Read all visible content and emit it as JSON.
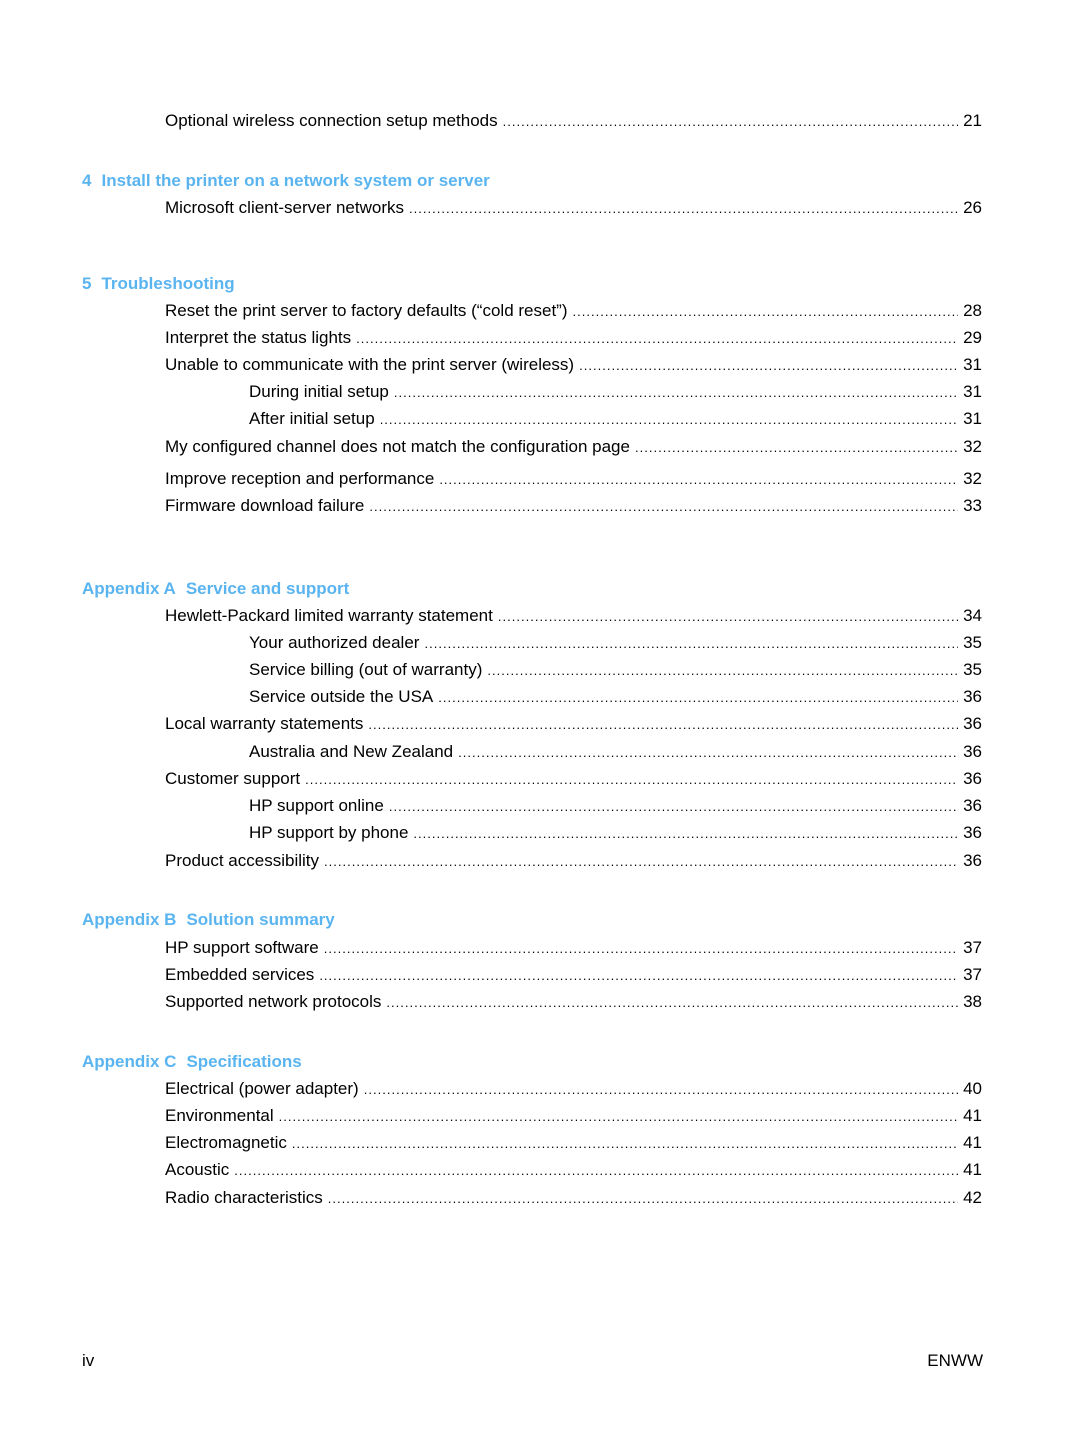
{
  "document": {
    "type": "table-of-contents",
    "accent_color": "#5ab4f0"
  },
  "toc": {
    "top_entries": [
      {
        "title": "Optional wireless connection setup methods",
        "page": "21",
        "level": 1
      }
    ],
    "sections": [
      {
        "number": "4",
        "title": "Install the printer on a network system or server",
        "entries": [
          {
            "title": "Microsoft client-server networks",
            "page": "26",
            "level": 1
          }
        ]
      },
      {
        "number": "5",
        "title": "Troubleshooting",
        "entries": [
          {
            "title": "Reset the print server to factory defaults (“cold reset”)",
            "page": "28",
            "level": 1
          },
          {
            "title": "Interpret the status lights",
            "page": "29",
            "level": 1
          },
          {
            "title": "Unable to communicate with the print server (wireless)",
            "page": "31",
            "level": 1
          },
          {
            "title": "During initial setup",
            "page": "31",
            "level": 2
          },
          {
            "title": "After initial setup",
            "page": "31",
            "level": 2
          },
          {
            "title": "My configured channel does not match the configuration page",
            "page": "32",
            "level": 1
          },
          {
            "title": "Improve reception and performance",
            "page": "32",
            "level": 1
          },
          {
            "title": "Firmware download failure",
            "page": "33",
            "level": 1
          }
        ]
      },
      {
        "number": "Appendix A",
        "title": "Service and support",
        "entries": [
          {
            "title": "Hewlett-Packard limited warranty statement",
            "page": "34",
            "level": 1
          },
          {
            "title": "Your authorized dealer",
            "page": "35",
            "level": 2
          },
          {
            "title": "Service billing (out of warranty)",
            "page": "35",
            "level": 2
          },
          {
            "title": "Service outside the USA",
            "page": "36",
            "level": 2
          },
          {
            "title": "Local warranty statements",
            "page": "36",
            "level": 1
          },
          {
            "title": "Australia and New Zealand",
            "page": "36",
            "level": 2
          },
          {
            "title": "Customer support",
            "page": "36",
            "level": 1
          },
          {
            "title": "HP support online",
            "page": "36",
            "level": 2
          },
          {
            "title": "HP support by phone",
            "page": "36",
            "level": 2
          },
          {
            "title": "Product accessibility",
            "page": "36",
            "level": 1
          }
        ]
      },
      {
        "number": "Appendix B",
        "title": "Solution summary",
        "entries": [
          {
            "title": "HP support software",
            "page": "37",
            "level": 1
          },
          {
            "title": "Embedded services",
            "page": "37",
            "level": 1
          },
          {
            "title": "Supported network protocols",
            "page": "38",
            "level": 1
          }
        ]
      },
      {
        "number": "Appendix C",
        "title": "Specifications",
        "entries": [
          {
            "title": "Electrical (power adapter)",
            "page": "40",
            "level": 1
          },
          {
            "title": "Environmental",
            "page": "41",
            "level": 1
          },
          {
            "title": "Electromagnetic",
            "page": "41",
            "level": 1
          },
          {
            "title": "Acoustic",
            "page": "41",
            "level": 1
          },
          {
            "title": "Radio characteristics",
            "page": "42",
            "level": 1
          }
        ]
      }
    ]
  },
  "footer": {
    "page_number": "iv",
    "locale_code": "ENWW"
  }
}
